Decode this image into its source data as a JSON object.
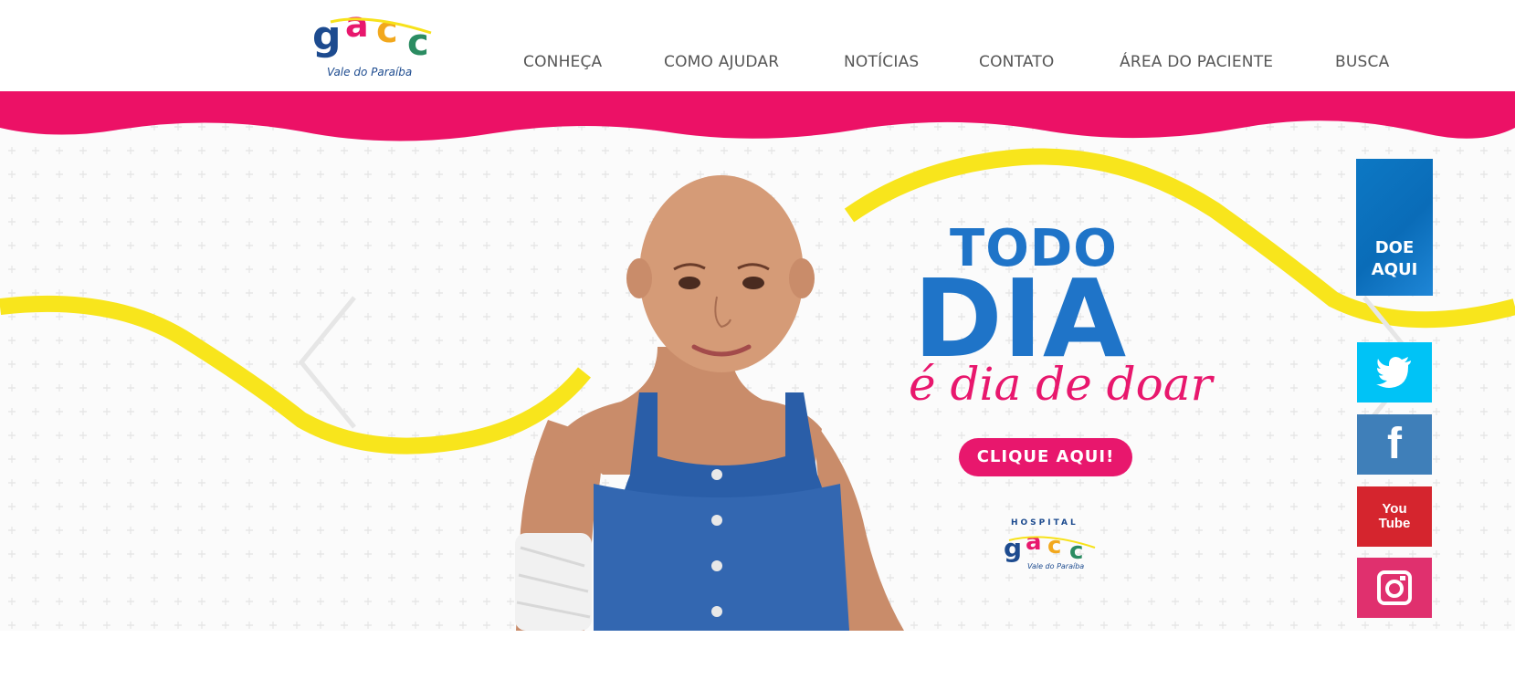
{
  "header": {
    "logo": {
      "letters": [
        "g",
        "a",
        "c",
        "c"
      ],
      "subtitle": "Vale do Paraíba"
    },
    "nav": [
      {
        "label": "CONHEÇA"
      },
      {
        "label": "COMO AJUDAR"
      },
      {
        "label": "NOTÍCIAS"
      },
      {
        "label": "CONTATO"
      },
      {
        "label": "ÁREA DO PACIENTE"
      },
      {
        "label": "BUSCA"
      }
    ]
  },
  "hero": {
    "line1": "TODO",
    "line2": "DIA",
    "line3": "é dia de doar",
    "cta": "CLIQUE AQUI!",
    "hospital_logo": {
      "top": "HOSPITAL",
      "letters": [
        "g",
        "a",
        "c",
        "c"
      ],
      "subtitle": "Vale do Paraíba"
    }
  },
  "sidebar": {
    "donate": {
      "line1": "DOE",
      "line2": "AQUI"
    },
    "social": [
      {
        "icon": "twitter-icon",
        "glyph": "",
        "color": "#00c3f6"
      },
      {
        "icon": "facebook-icon",
        "glyph": "f",
        "color": "#3f7fb9"
      },
      {
        "icon": "youtube-icon",
        "glyph": "You Tube",
        "color": "#d5252e"
      },
      {
        "icon": "instagram-icon",
        "glyph": "",
        "color": "#e0306e"
      }
    ]
  },
  "colors": {
    "brand_pink": "#e8176d",
    "brand_blue": "#1f74c8",
    "wave_yellow": "#f7e21a",
    "nav_text": "#555555"
  }
}
